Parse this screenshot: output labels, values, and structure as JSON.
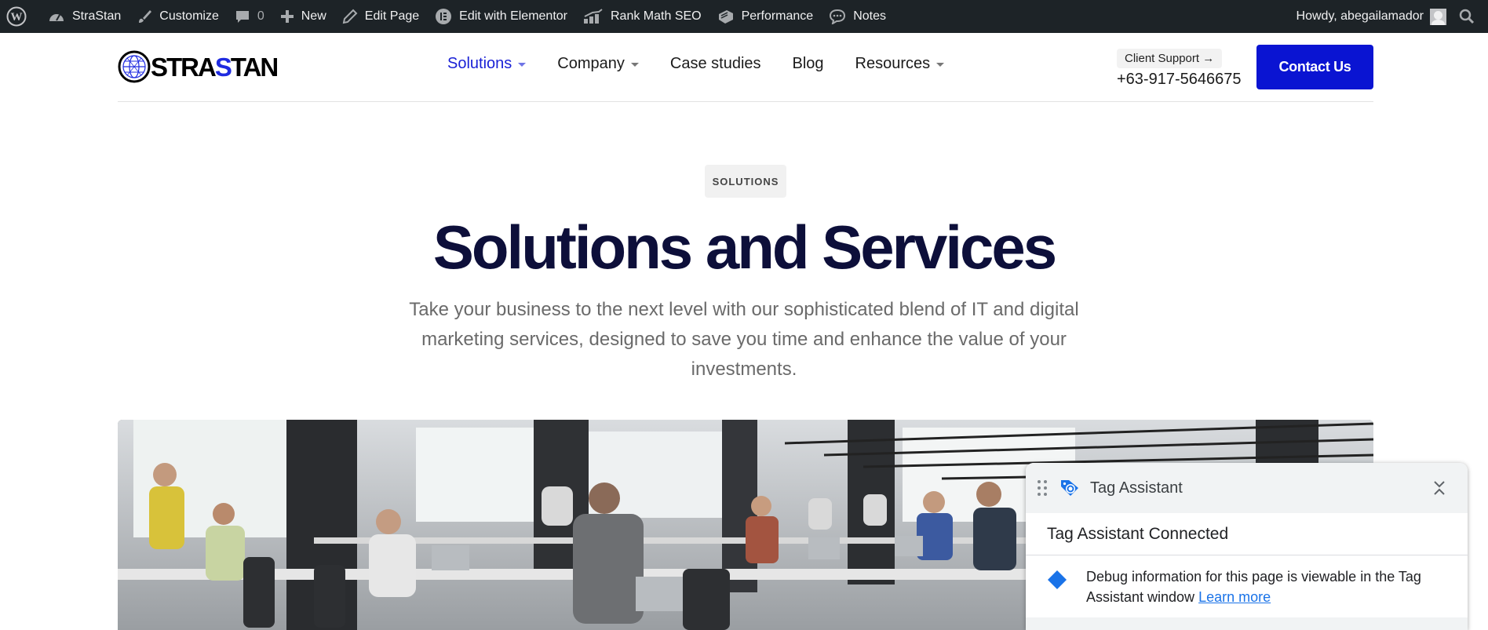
{
  "admin_bar": {
    "site_name": "StraStan",
    "customize": "Customize",
    "comments_count": "0",
    "new": "New",
    "edit_page": "Edit Page",
    "edit_elementor": "Edit with Elementor",
    "rank_math": "Rank Math SEO",
    "performance": "Performance",
    "notes": "Notes",
    "howdy": "Howdy, abegailamador"
  },
  "header": {
    "logo_part1": "STRA",
    "logo_part2": "S",
    "logo_part3": "TAN",
    "nav": [
      {
        "label": "Solutions",
        "active": true,
        "dropdown": true
      },
      {
        "label": "Company",
        "active": false,
        "dropdown": true
      },
      {
        "label": "Case studies",
        "active": false,
        "dropdown": false
      },
      {
        "label": "Blog",
        "active": false,
        "dropdown": false
      },
      {
        "label": "Resources",
        "active": false,
        "dropdown": true
      }
    ],
    "support_label": "Client Support →",
    "support_phone": "+63-917-5646675",
    "contact_button": "Contact Us"
  },
  "hero": {
    "tag": "SOLUTIONS",
    "title": "Solutions and Services",
    "subtitle": "Take your business to the next level with our sophisticated blend of IT and digital marketing services, designed to save you time and enhance the value of your investments."
  },
  "tag_assistant": {
    "title": "Tag Assistant",
    "status": "Tag Assistant Connected",
    "debug_text": "Debug information for this page is viewable in the Tag Assistant window",
    "learn_more": "Learn more"
  },
  "colors": {
    "admin_bar_bg": "#1d2327",
    "brand_blue": "#0a14d2",
    "title_navy": "#0d0f3a",
    "link_blue": "#1a73e8"
  }
}
